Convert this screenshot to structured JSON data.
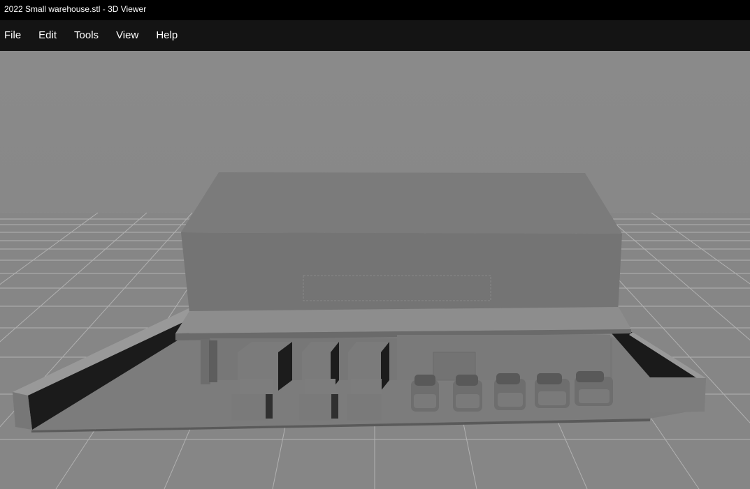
{
  "window": {
    "title": "2022 Small warehouse.stl - 3D Viewer"
  },
  "menu": {
    "items": [
      {
        "label": "File"
      },
      {
        "label": "Edit"
      },
      {
        "label": "Tools"
      },
      {
        "label": "View"
      },
      {
        "label": "Help"
      }
    ]
  },
  "viewport": {
    "model": "small-warehouse",
    "grid": true,
    "colors": {
      "background": "#8a8a8a",
      "ground": "#828282",
      "grid_line": "#b4b4b4",
      "model_light": "#7a7a7a",
      "model_dark": "#1a1a1a"
    }
  }
}
